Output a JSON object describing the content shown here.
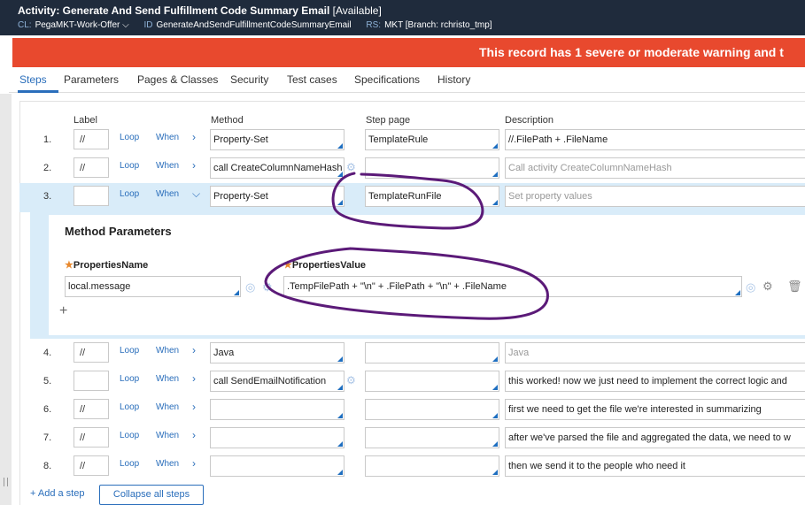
{
  "header": {
    "title": "Activity: Generate And Send Fulfillment Code Summary Email",
    "status": "[Available]",
    "cl_label": "CL:",
    "cl_value": "PegaMKT-Work-Offer",
    "id_label": "ID",
    "id_value": "GenerateAndSendFulfillmentCodeSummaryEmail",
    "rs_label": "RS:",
    "rs_value": "MKT [Branch: rchristo_tmp]"
  },
  "warning": {
    "text": "This record has 1 severe or moderate warning and t"
  },
  "tabs": [
    {
      "label": "Steps"
    },
    {
      "label": "Parameters"
    },
    {
      "label": "Pages & Classes"
    },
    {
      "label": "Security"
    },
    {
      "label": "Test cases"
    },
    {
      "label": "Specifications"
    },
    {
      "label": "History"
    }
  ],
  "columns": {
    "label": "Label",
    "method": "Method",
    "step_page": "Step page",
    "description": "Description"
  },
  "steps": [
    {
      "num": "1.",
      "label": "//",
      "loop": "Loop",
      "when": "When",
      "method": "Property-Set",
      "step_page": "TemplateRule",
      "description": "//.FilePath + .FileName",
      "description_placeholder": false
    },
    {
      "num": "2.",
      "label": "//",
      "loop": "Loop",
      "when": "When",
      "method": "call CreateColumnNameHash",
      "step_page": "",
      "description": "Call activity CreateColumnNameHash",
      "description_placeholder": true
    },
    {
      "num": "3.",
      "label": "",
      "loop": "Loop",
      "when": "When",
      "method": "Property-Set",
      "step_page": "TemplateRunFile",
      "description": "Set property values",
      "description_placeholder": true
    },
    {
      "num": "4.",
      "label": "//",
      "loop": "Loop",
      "when": "When",
      "method": "Java",
      "step_page": "",
      "description": "Java",
      "description_placeholder": true
    },
    {
      "num": "5.",
      "label": "",
      "loop": "Loop",
      "when": "When",
      "method": "call SendEmailNotification",
      "step_page": "",
      "description": "this worked! now we just need to implement the correct logic and",
      "description_placeholder": false
    },
    {
      "num": "6.",
      "label": "//",
      "loop": "Loop",
      "when": "When",
      "method": "",
      "step_page": "",
      "description": "first we need to get the file we're interested in summarizing",
      "description_placeholder": false
    },
    {
      "num": "7.",
      "label": "//",
      "loop": "Loop",
      "when": "When",
      "method": "",
      "step_page": "",
      "description": "after we've parsed the file and aggregated the data, we need to w",
      "description_placeholder": false
    },
    {
      "num": "8.",
      "label": "//",
      "loop": "Loop",
      "when": "When",
      "method": "",
      "step_page": "",
      "description": "then we send it to the people who need it",
      "description_placeholder": false
    }
  ],
  "method_parameters": {
    "title": "Method Parameters",
    "properties_name_label": "PropertiesName",
    "properties_value_label": "PropertiesValue",
    "properties_name": "local.message",
    "properties_value": ".TempFilePath + \"\\n\" + .FilePath + \"\\n\" + .FileName"
  },
  "footer": {
    "add_step": "Add a step",
    "collapse_all": "Collapse all steps"
  },
  "colors": {
    "header_bg": "#1f2b3c",
    "warning_bg": "#e8492e",
    "accent": "#2a6ebb",
    "selected_row": "#d9ecf9",
    "annotation": "#5b1a78"
  }
}
